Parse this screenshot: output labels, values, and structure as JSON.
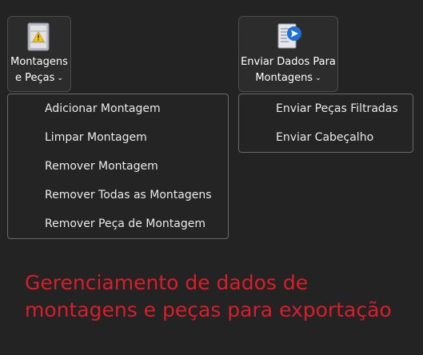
{
  "buttons": {
    "montagens": {
      "label_line1": "Montagens",
      "label_line2": "e Peças",
      "icon": "warning-cabinet-icon"
    },
    "enviar": {
      "label_line1": "Enviar Dados Para",
      "label_line2": "Montagens",
      "icon": "send-document-icon"
    }
  },
  "menus": {
    "montagens": {
      "items": [
        {
          "label": "Adicionar Montagem"
        },
        {
          "label": "Limpar Montagem"
        },
        {
          "label": "Remover Montagem"
        },
        {
          "label": "Remover Todas as Montagens"
        },
        {
          "label": "Remover Peça de Montagem"
        }
      ]
    },
    "enviar": {
      "items": [
        {
          "label": "Enviar Peças Filtradas"
        },
        {
          "label": "Enviar Cabeçalho"
        }
      ]
    }
  },
  "caption": {
    "line1": "Gerenciamento de dados de",
    "line2": "montagens e peças para exportação"
  },
  "colors": {
    "background": "#232323",
    "caption": "#d81e2a",
    "accent_blue": "#1e6fd9",
    "warning_yellow": "#f5c518"
  }
}
